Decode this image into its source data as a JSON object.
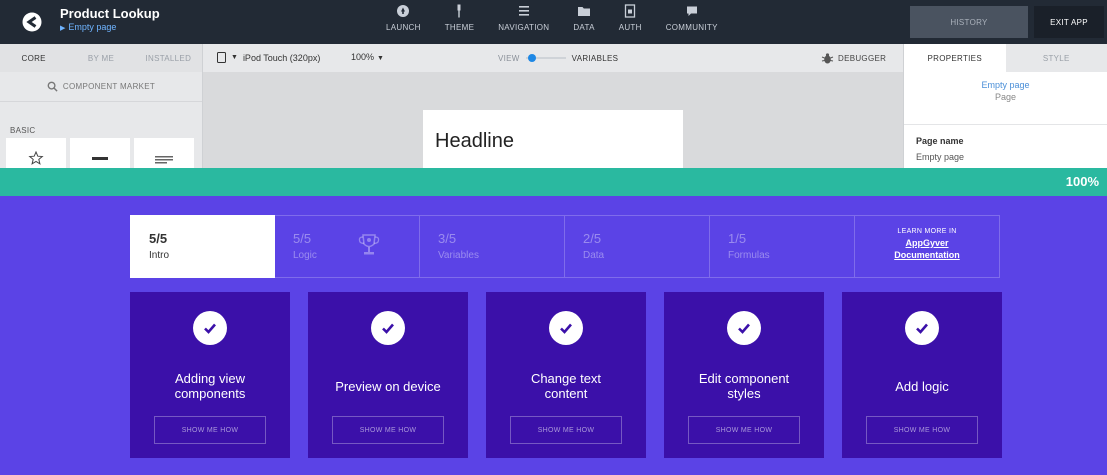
{
  "app": {
    "title": "Product Lookup",
    "subtitle": "Empty page"
  },
  "nav": [
    {
      "label": "LAUNCH",
      "icon": "rocket-icon"
    },
    {
      "label": "THEME",
      "icon": "brush-icon"
    },
    {
      "label": "NAVIGATION",
      "icon": "list-icon"
    },
    {
      "label": "DATA",
      "icon": "folder-icon"
    },
    {
      "label": "AUTH",
      "icon": "lock-icon"
    },
    {
      "label": "COMMUNITY",
      "icon": "chat-icon"
    }
  ],
  "topbar_buttons": {
    "history": "HISTORY",
    "exit": "EXIT APP"
  },
  "left_panel": {
    "tabs": [
      "CORE",
      "BY ME",
      "INSTALLED"
    ],
    "active_tab": "CORE",
    "market_label": "COMPONENT MARKET",
    "section_label": "BASIC"
  },
  "toolbar": {
    "device": "iPod Touch (320px)",
    "zoom": "100%",
    "view_label": "VIEW",
    "variables_label": "VARIABLES",
    "debugger_label": "DEBUGGER"
  },
  "canvas": {
    "headline": "Headline"
  },
  "right_panel": {
    "tabs": [
      "PROPERTIES",
      "STYLE"
    ],
    "active_tab": "PROPERTIES",
    "page_name": "Empty page",
    "page_type": "Page",
    "field_label": "Page name",
    "field_value": "Empty page"
  },
  "progress": {
    "percent_label": "100%",
    "percent": 100
  },
  "steps": [
    {
      "count": "5/5",
      "name": "Intro",
      "active": true
    },
    {
      "count": "5/5",
      "name": "Logic",
      "active": false
    },
    {
      "count": "3/5",
      "name": "Variables",
      "active": false
    },
    {
      "count": "2/5",
      "name": "Data",
      "active": false
    },
    {
      "count": "1/5",
      "name": "Formulas",
      "active": false
    }
  ],
  "learn_more": {
    "top": "LEARN MORE IN",
    "line1": "AppGyver",
    "line2": "Documentation"
  },
  "cards": [
    {
      "line1": "Adding view",
      "line2": "components",
      "button": "SHOW ME HOW"
    },
    {
      "line1": "Preview on device",
      "line2": "",
      "button": "SHOW ME HOW"
    },
    {
      "line1": "Change text",
      "line2": "content",
      "button": "SHOW ME HOW"
    },
    {
      "line1": "Edit component",
      "line2": "styles",
      "button": "SHOW ME HOW"
    },
    {
      "line1": "Add logic",
      "line2": "",
      "button": "SHOW ME HOW"
    }
  ],
  "colors": {
    "topbar": "#222a35",
    "progress": "#2ab9a0",
    "tutorial_bg": "#5b43e6",
    "card_bg": "#3b10a9",
    "link_blue": "#4a8fd8"
  }
}
